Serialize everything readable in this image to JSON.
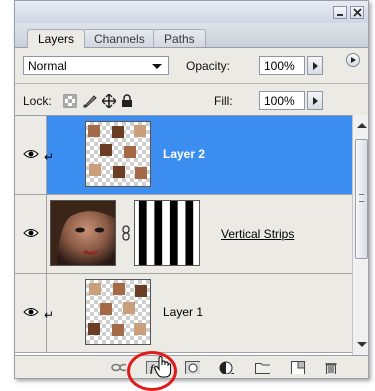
{
  "tabs": [
    {
      "label": "Layers",
      "active": true
    },
    {
      "label": "Channels",
      "active": false
    },
    {
      "label": "Paths",
      "active": false
    }
  ],
  "blend_mode": {
    "selected": "Normal"
  },
  "opacity": {
    "label": "Opacity:",
    "value": "100%"
  },
  "lock": {
    "label": "Lock:",
    "icons": [
      "lock-transparent-icon",
      "lock-image-icon",
      "lock-position-icon",
      "lock-all-icon"
    ]
  },
  "fill": {
    "label": "Fill:",
    "value": "100%"
  },
  "layers": [
    {
      "name": "Layer 2",
      "selected": true,
      "visible": true,
      "clipped": true,
      "thumbnail": "checker-tiles"
    },
    {
      "name": "Vertical Strips",
      "selected": false,
      "visible": true,
      "clipped": false,
      "thumbnail": "portrait",
      "mask": "vertical-strips-mask",
      "linked": true
    },
    {
      "name": "Layer 1",
      "selected": false,
      "visible": true,
      "clipped": true,
      "thumbnail": "checker-tiles"
    }
  ],
  "bottom_toolbar": [
    "link-layers-icon",
    "layer-style-icon",
    "add-mask-icon",
    "adjustment-layer-icon",
    "new-group-icon",
    "new-layer-icon",
    "trash-icon"
  ],
  "colors": {
    "selection": "#3b8ef0",
    "highlight_circle": "#e01b1b",
    "panel_bg": "#eceae4"
  }
}
